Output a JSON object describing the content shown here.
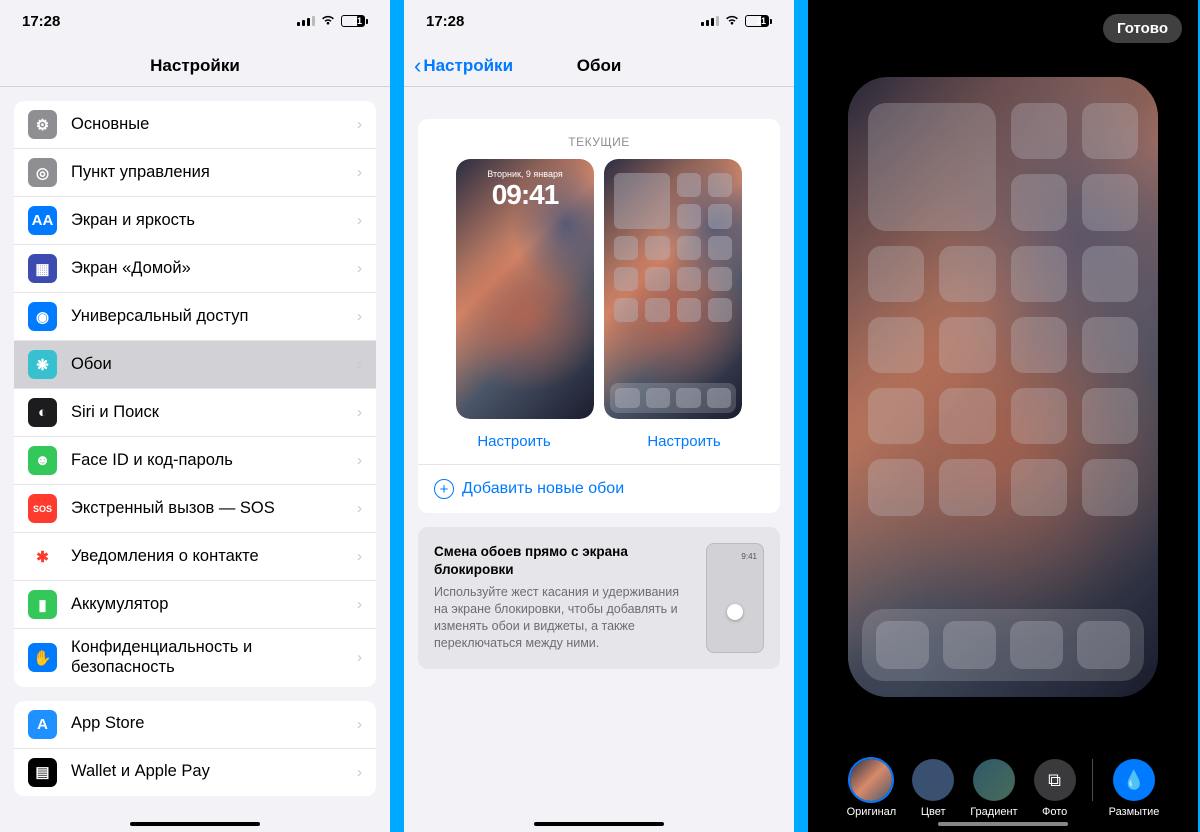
{
  "status": {
    "time": "17:28",
    "battery": "31"
  },
  "p1": {
    "title": "Настройки",
    "items": [
      {
        "label": "Основные",
        "bg": "#8e8e93",
        "icon": "⚙"
      },
      {
        "label": "Пункт управления",
        "bg": "#8e8e93",
        "icon": "◎"
      },
      {
        "label": "Экран и яркость",
        "bg": "#007aff",
        "icon": "AA"
      },
      {
        "label": "Экран «Домой»",
        "bg": "#3d4ab0",
        "icon": "▦"
      },
      {
        "label": "Универсальный доступ",
        "bg": "#007aff",
        "icon": "◉"
      },
      {
        "label": "Обои",
        "bg": "#37c1d0",
        "icon": "❋",
        "sel": true
      },
      {
        "label": "Siri и Поиск",
        "bg": "#1c1c1e",
        "icon": "◐"
      },
      {
        "label": "Face ID и код-пароль",
        "bg": "#34c759",
        "icon": "☻"
      },
      {
        "label": "Экстренный вызов — SOS",
        "bg": "#ff3b30",
        "icon": "SOS"
      },
      {
        "label": "Уведомления о контакте",
        "bg": "#ffffff",
        "icon": "✱",
        "fg": "#ff3b30"
      },
      {
        "label": "Аккумулятор",
        "bg": "#34c759",
        "icon": "▮"
      },
      {
        "label": "Конфиденциальность и безопасность",
        "bg": "#007aff",
        "icon": "✋"
      }
    ],
    "items2": [
      {
        "label": "App Store",
        "bg": "#1e90ff",
        "icon": "A"
      },
      {
        "label": "Wallet и Apple Pay",
        "bg": "#000",
        "icon": "▤"
      }
    ]
  },
  "p2": {
    "back": "Настройки",
    "title": "Обои",
    "current": "ТЕКУЩИЕ",
    "lock_date": "Вторник, 9 января",
    "lock_time": "09:41",
    "customize": "Настроить",
    "addnew": "Добавить новые обои",
    "tip_title": "Смена обоев прямо с экрана блокировки",
    "tip_body": "Используйте жест касания и удерживания на экране блокировки, чтобы добавлять и изменять обои и виджеты, а также переключаться между ними.",
    "tip_time": "9:41"
  },
  "p3": {
    "done": "Готово",
    "opts": [
      {
        "label": "Оригинал",
        "type": "img"
      },
      {
        "label": "Цвет",
        "bg": "#3a5070"
      },
      {
        "label": "Градиент",
        "bg": "linear-gradient(135deg,#2d5a6a,#4a6a5a)"
      },
      {
        "label": "Фото",
        "bg": "#3a3a3c",
        "icon": "⧉"
      }
    ],
    "blur": "Размытие"
  }
}
